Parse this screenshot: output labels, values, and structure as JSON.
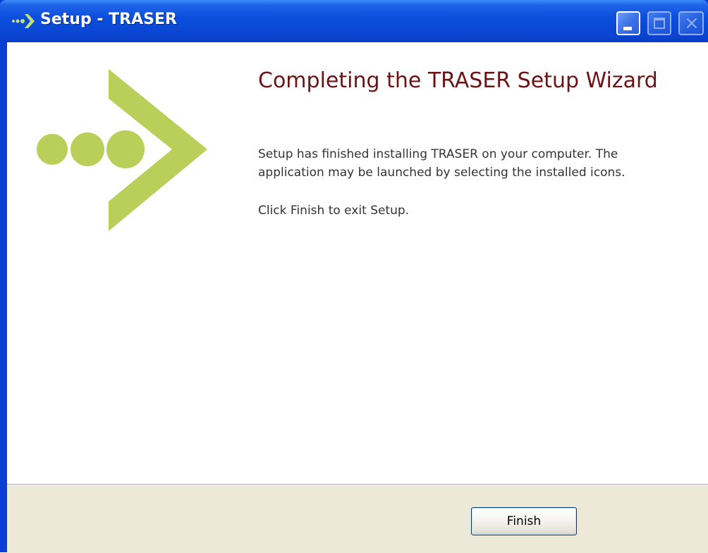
{
  "window": {
    "title": "Setup - TRASER",
    "icon": "green-arrow-icon",
    "controls": {
      "minimize": "minimize-icon",
      "maximize": "maximize-icon",
      "close": "close-icon"
    }
  },
  "wizard": {
    "graphic": "green-arrow-dots-graphic",
    "heading": "Completing the TRASER Setup Wizard",
    "paragraphs": [
      "Setup has finished installing TRASER on your computer. The application may be launched by selecting the installed icons.",
      "Click Finish to exit Setup."
    ]
  },
  "footer": {
    "finish_label": "Finish"
  },
  "colors": {
    "brand_green": "#b9cf5a",
    "heading": "#6b1414",
    "titlebar": "#0a4fdc",
    "footer_bg": "#ece9d8"
  }
}
